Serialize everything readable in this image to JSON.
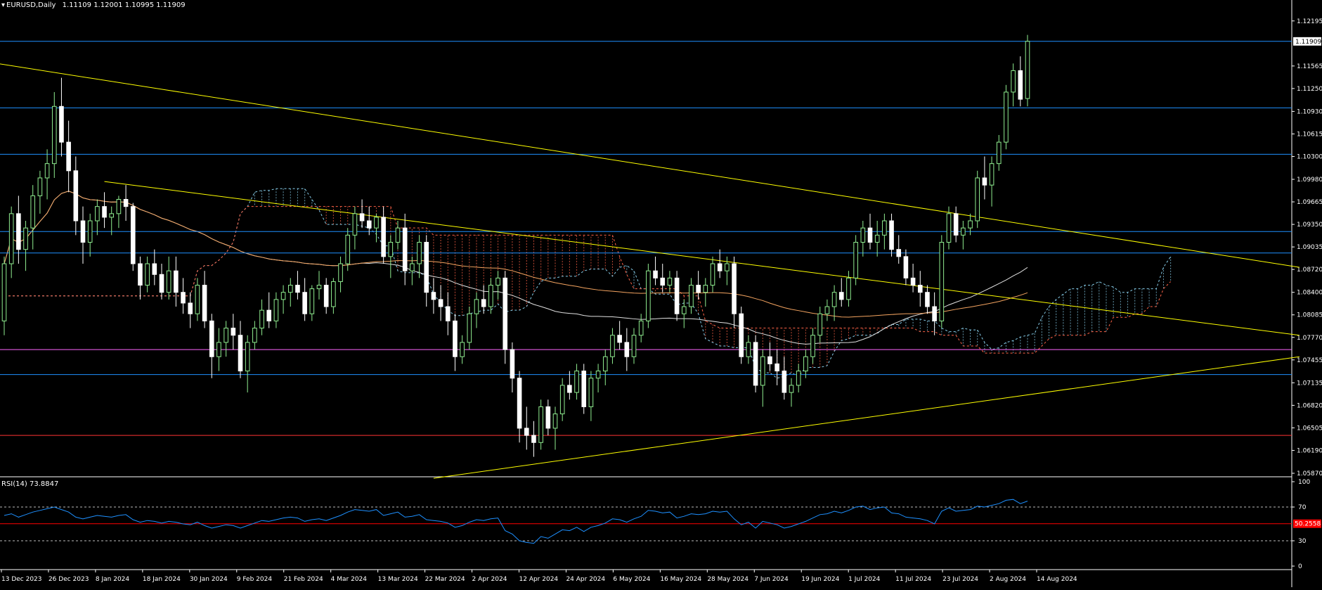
{
  "header": {
    "symbol": "EURUSD,Daily",
    "ohlc": "1.11109 1.12001 1.10995 1.11909"
  },
  "rsi_header": {
    "label": "RSI(14) 73.8847"
  },
  "colors": {
    "background": "#000000",
    "bull": "#90EE90",
    "bear": "#FFFFFF",
    "level_line": "#1E90FF",
    "trendline": "#FFFF00",
    "support_line": "#FF3333",
    "magenta_line": "#FF66FF",
    "kumo_bull": "#87CEEB",
    "kumo_bear": "#FF6347",
    "ma_slow": "#F4A460",
    "ma_fast": "#E0E0E0",
    "rsi": "#1E90FF"
  },
  "chart_data": [
    {
      "type": "candlestick",
      "title": "EURUSD,Daily",
      "price_ticks": [
        "1.12195",
        "1.11565",
        "1.11250",
        "1.10930",
        "1.10615",
        "1.10300",
        "1.09980",
        "1.09665",
        "1.09350",
        "1.09035",
        "1.08720",
        "1.08400",
        "1.08085",
        "1.07770",
        "1.07455",
        "1.07135",
        "1.06820",
        "1.06505",
        "1.06190",
        "1.05870"
      ],
      "current_price_label": "1.11909",
      "ylim": [
        1.0587,
        1.1235
      ],
      "date_labels": [
        "13 Dec 2023",
        "26 Dec 2023",
        "8 Jan 2024",
        "18 Jan 2024",
        "30 Jan 2024",
        "9 Feb 2024",
        "21 Feb 2024",
        "4 Mar 2024",
        "13 Mar 2024",
        "22 Mar 2024",
        "2 Apr 2024",
        "12 Apr 2024",
        "24 Apr 2024",
        "6 May 2024",
        "16 May 2024",
        "28 May 2024",
        "7 Jun 2024",
        "19 Jun 2024",
        "1 Jul 2024",
        "11 Jul 2024",
        "23 Jul 2024",
        "2 Aug 2024",
        "14 Aug 2024"
      ],
      "ohlc": [
        [
          1.08,
          1.089,
          1.078,
          1.088
        ],
        [
          1.088,
          1.096,
          1.086,
          1.095
        ],
        [
          1.095,
          1.0975,
          1.088,
          1.09
        ],
        [
          1.09,
          1.094,
          1.087,
          1.093
        ],
        [
          1.093,
          1.099,
          1.09,
          1.0975
        ],
        [
          1.0975,
          1.101,
          1.095,
          1.1
        ],
        [
          1.1,
          1.104,
          1.097,
          1.102
        ],
        [
          1.102,
          1.112,
          1.1,
          1.11
        ],
        [
          1.11,
          1.114,
          1.103,
          1.105
        ],
        [
          1.105,
          1.108,
          1.098,
          1.101
        ],
        [
          1.101,
          1.103,
          1.092,
          1.094
        ],
        [
          1.094,
          1.096,
          1.088,
          1.091
        ],
        [
          1.091,
          1.095,
          1.089,
          1.094
        ],
        [
          1.094,
          1.097,
          1.092,
          1.096
        ],
        [
          1.096,
          1.098,
          1.093,
          1.0945
        ],
        [
          1.0945,
          1.096,
          1.092,
          1.095
        ],
        [
          1.095,
          1.0975,
          1.093,
          1.097
        ],
        [
          1.097,
          1.099,
          1.094,
          1.096
        ],
        [
          1.096,
          1.0965,
          1.087,
          1.088
        ],
        [
          1.088,
          1.089,
          1.083,
          1.085
        ],
        [
          1.085,
          1.089,
          1.084,
          1.088
        ],
        [
          1.088,
          1.09,
          1.085,
          1.0865
        ],
        [
          1.0865,
          1.088,
          1.083,
          1.084
        ],
        [
          1.084,
          1.089,
          1.083,
          1.087
        ],
        [
          1.087,
          1.089,
          1.082,
          1.084
        ],
        [
          1.084,
          1.086,
          1.081,
          1.0825
        ],
        [
          1.0825,
          1.084,
          1.079,
          1.081
        ],
        [
          1.081,
          1.086,
          1.08,
          1.085
        ],
        [
          1.085,
          1.087,
          1.079,
          1.08
        ],
        [
          1.08,
          1.081,
          1.072,
          1.075
        ],
        [
          1.075,
          1.079,
          1.073,
          1.077
        ],
        [
          1.077,
          1.08,
          1.075,
          1.079
        ],
        [
          1.079,
          1.081,
          1.076,
          1.078
        ],
        [
          1.078,
          1.08,
          1.072,
          1.073
        ],
        [
          1.073,
          1.078,
          1.07,
          1.077
        ],
        [
          1.077,
          1.08,
          1.076,
          1.079
        ],
        [
          1.079,
          1.083,
          1.078,
          1.0815
        ],
        [
          1.0815,
          1.084,
          1.079,
          1.08
        ],
        [
          1.08,
          1.084,
          1.079,
          1.083
        ],
        [
          1.083,
          1.085,
          1.081,
          1.084
        ],
        [
          1.084,
          1.086,
          1.082,
          1.085
        ],
        [
          1.085,
          1.087,
          1.083,
          1.084
        ],
        [
          1.084,
          1.086,
          1.08,
          1.081
        ],
        [
          1.081,
          1.085,
          1.08,
          1.0845
        ],
        [
          1.0845,
          1.087,
          1.083,
          1.085
        ],
        [
          1.085,
          1.086,
          1.081,
          1.082
        ],
        [
          1.082,
          1.086,
          1.081,
          1.0855
        ],
        [
          1.0855,
          1.089,
          1.084,
          1.088
        ],
        [
          1.088,
          1.093,
          1.087,
          1.092
        ],
        [
          1.092,
          1.096,
          1.09,
          1.095
        ],
        [
          1.095,
          1.097,
          1.093,
          1.094
        ],
        [
          1.094,
          1.096,
          1.092,
          1.093
        ],
        [
          1.093,
          1.095,
          1.091,
          1.0945
        ],
        [
          1.0945,
          1.096,
          1.088,
          1.089
        ],
        [
          1.089,
          1.092,
          1.086,
          1.091
        ],
        [
          1.091,
          1.094,
          1.09,
          1.093
        ],
        [
          1.093,
          1.095,
          1.085,
          1.087
        ],
        [
          1.087,
          1.089,
          1.085,
          1.088
        ],
        [
          1.088,
          1.092,
          1.086,
          1.091
        ],
        [
          1.091,
          1.092,
          1.082,
          1.084
        ],
        [
          1.084,
          1.086,
          1.081,
          1.083
        ],
        [
          1.083,
          1.085,
          1.08,
          1.082
        ],
        [
          1.082,
          1.084,
          1.078,
          1.08
        ],
        [
          1.08,
          1.081,
          1.073,
          1.075
        ],
        [
          1.075,
          1.078,
          1.074,
          1.077
        ],
        [
          1.077,
          1.082,
          1.076,
          1.081
        ],
        [
          1.081,
          1.084,
          1.079,
          1.083
        ],
        [
          1.083,
          1.085,
          1.081,
          1.082
        ],
        [
          1.082,
          1.086,
          1.081,
          1.085
        ],
        [
          1.085,
          1.087,
          1.083,
          1.086
        ],
        [
          1.086,
          1.087,
          1.074,
          1.076
        ],
        [
          1.076,
          1.077,
          1.07,
          1.072
        ],
        [
          1.072,
          1.073,
          1.063,
          1.065
        ],
        [
          1.065,
          1.068,
          1.062,
          1.064
        ],
        [
          1.064,
          1.066,
          1.061,
          1.063
        ],
        [
          1.063,
          1.069,
          1.062,
          1.068
        ],
        [
          1.068,
          1.069,
          1.064,
          1.065
        ],
        [
          1.065,
          1.068,
          1.062,
          1.067
        ],
        [
          1.067,
          1.072,
          1.066,
          1.071
        ],
        [
          1.071,
          1.073,
          1.069,
          1.07
        ],
        [
          1.07,
          1.074,
          1.069,
          1.073
        ],
        [
          1.073,
          1.074,
          1.067,
          1.068
        ],
        [
          1.068,
          1.073,
          1.066,
          1.072
        ],
        [
          1.072,
          1.074,
          1.07,
          1.073
        ],
        [
          1.073,
          1.076,
          1.071,
          1.075
        ],
        [
          1.075,
          1.079,
          1.074,
          1.078
        ],
        [
          1.078,
          1.08,
          1.076,
          1.077
        ],
        [
          1.077,
          1.079,
          1.073,
          1.075
        ],
        [
          1.075,
          1.079,
          1.074,
          1.078
        ],
        [
          1.078,
          1.081,
          1.077,
          1.08
        ],
        [
          1.08,
          1.088,
          1.079,
          1.087
        ],
        [
          1.087,
          1.089,
          1.085,
          1.086
        ],
        [
          1.086,
          1.088,
          1.084,
          1.085
        ],
        [
          1.085,
          1.087,
          1.084,
          1.086
        ],
        [
          1.086,
          1.087,
          1.08,
          1.081
        ],
        [
          1.081,
          1.083,
          1.079,
          1.082
        ],
        [
          1.082,
          1.086,
          1.081,
          1.085
        ],
        [
          1.085,
          1.087,
          1.083,
          1.084
        ],
        [
          1.084,
          1.086,
          1.082,
          1.085
        ],
        [
          1.085,
          1.089,
          1.084,
          1.088
        ],
        [
          1.088,
          1.09,
          1.086,
          1.087
        ],
        [
          1.087,
          1.089,
          1.085,
          1.088
        ],
        [
          1.088,
          1.089,
          1.079,
          1.081
        ],
        [
          1.081,
          1.082,
          1.074,
          1.075
        ],
        [
          1.075,
          1.078,
          1.074,
          1.077
        ],
        [
          1.077,
          1.078,
          1.07,
          1.071
        ],
        [
          1.071,
          1.076,
          1.068,
          1.075
        ],
        [
          1.075,
          1.077,
          1.073,
          1.074
        ],
        [
          1.074,
          1.076,
          1.071,
          1.073
        ],
        [
          1.073,
          1.075,
          1.069,
          1.07
        ],
        [
          1.07,
          1.072,
          1.068,
          1.071
        ],
        [
          1.071,
          1.074,
          1.07,
          1.073
        ],
        [
          1.073,
          1.076,
          1.072,
          1.075
        ],
        [
          1.075,
          1.079,
          1.074,
          1.078
        ],
        [
          1.078,
          1.082,
          1.077,
          1.081
        ],
        [
          1.081,
          1.083,
          1.08,
          1.082
        ],
        [
          1.082,
          1.085,
          1.08,
          1.084
        ],
        [
          1.084,
          1.086,
          1.082,
          1.083
        ],
        [
          1.083,
          1.087,
          1.082,
          1.086
        ],
        [
          1.086,
          1.092,
          1.085,
          1.091
        ],
        [
          1.091,
          1.094,
          1.089,
          1.093
        ],
        [
          1.093,
          1.095,
          1.09,
          1.091
        ],
        [
          1.091,
          1.094,
          1.089,
          1.092
        ],
        [
          1.092,
          1.095,
          1.09,
          1.094
        ],
        [
          1.094,
          1.095,
          1.089,
          1.09
        ],
        [
          1.09,
          1.092,
          1.088,
          1.089
        ],
        [
          1.089,
          1.09,
          1.085,
          1.086
        ],
        [
          1.086,
          1.088,
          1.084,
          1.085
        ],
        [
          1.085,
          1.087,
          1.082,
          1.084
        ],
        [
          1.084,
          1.085,
          1.081,
          1.082
        ],
        [
          1.082,
          1.084,
          1.078,
          1.08
        ],
        [
          1.08,
          1.092,
          1.079,
          1.091
        ],
        [
          1.091,
          1.096,
          1.09,
          1.095
        ],
        [
          1.095,
          1.096,
          1.091,
          1.092
        ],
        [
          1.092,
          1.094,
          1.09,
          1.093
        ],
        [
          1.093,
          1.095,
          1.092,
          1.094
        ],
        [
          1.094,
          1.101,
          1.093,
          1.1
        ],
        [
          1.1,
          1.103,
          1.097,
          1.099
        ],
        [
          1.099,
          1.103,
          1.096,
          1.102
        ],
        [
          1.102,
          1.106,
          1.101,
          1.105
        ],
        [
          1.105,
          1.113,
          1.104,
          1.112
        ],
        [
          1.112,
          1.116,
          1.11,
          1.115
        ],
        [
          1.115,
          1.117,
          1.11,
          1.111
        ],
        [
          1.1111,
          1.12,
          1.11,
          1.1191
        ]
      ],
      "horizontal_levels": [
        1.1191,
        1.1098,
        1.1033,
        1.0925,
        1.0895,
        1.076,
        1.0725,
        1.064
      ],
      "support_level": 1.064,
      "magenta_level": 1.076
    },
    {
      "type": "line",
      "title": "RSI(14) 73.8847",
      "yticks": [
        "100",
        "70",
        "50.2558",
        "30",
        "0"
      ],
      "ylim": [
        0,
        100
      ],
      "levels": [
        70,
        50.2558,
        30
      ],
      "rsi_values": [
        60,
        62,
        58,
        61,
        64,
        66,
        68,
        70,
        67,
        64,
        58,
        56,
        58,
        60,
        59,
        58,
        60,
        61,
        55,
        52,
        54,
        53,
        51,
        53,
        52,
        50,
        49,
        52,
        48,
        45,
        47,
        49,
        48,
        45,
        48,
        51,
        54,
        53,
        55,
        57,
        58,
        57,
        53,
        55,
        56,
        54,
        57,
        60,
        64,
        67,
        66,
        65,
        67,
        60,
        62,
        64,
        58,
        59,
        61,
        55,
        54,
        53,
        51,
        46,
        48,
        52,
        55,
        54,
        56,
        57,
        42,
        38,
        30,
        28,
        27,
        35,
        33,
        38,
        43,
        42,
        46,
        41,
        46,
        48,
        51,
        56,
        55,
        52,
        56,
        59,
        66,
        65,
        63,
        64,
        57,
        59,
        62,
        61,
        62,
        65,
        64,
        65,
        56,
        49,
        52,
        45,
        53,
        51,
        49,
        45,
        47,
        50,
        53,
        57,
        61,
        62,
        65,
        63,
        66,
        70,
        71,
        67,
        69,
        70,
        63,
        62,
        58,
        57,
        56,
        54,
        50,
        65,
        69,
        65,
        66,
        67,
        71,
        70,
        72,
        74,
        78,
        79,
        74,
        77
      ]
    }
  ]
}
